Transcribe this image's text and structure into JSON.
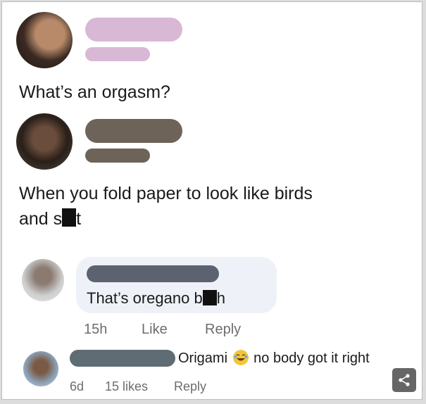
{
  "post1": {
    "text": "What’s an orgasm?"
  },
  "post2": {
    "text_part1": "When you fold paper to look like birds",
    "text_part2_prefix": "and s",
    "text_part2_suffix": "t"
  },
  "comment": {
    "text_prefix": "That’s oregano b",
    "text_suffix": "h",
    "time": "15h",
    "like": "Like",
    "reply": "Reply"
  },
  "reply": {
    "text_before": "Origami",
    "text_after": "no body got it right",
    "emoji": "laughing-emoji",
    "time": "6d",
    "likes": "15 likes",
    "reply": "Reply"
  },
  "colors": {
    "bar_pink": "#d9b8d6",
    "bar_brown": "#6d6359",
    "bar_slate": "#5d6271",
    "bar_teal": "#5f6c73"
  }
}
